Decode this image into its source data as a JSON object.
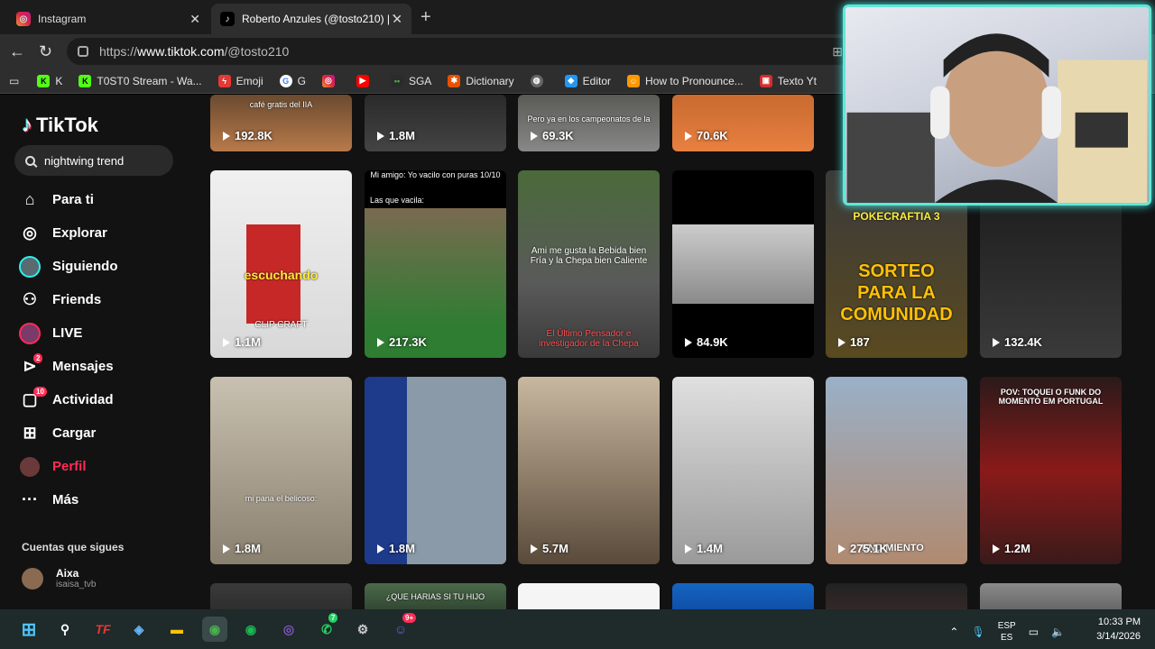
{
  "browser": {
    "tabs": [
      {
        "title": "Instagram",
        "active": false
      },
      {
        "title": "Roberto Anzules (@tosto210) | Tik",
        "active": true
      }
    ],
    "url_prefix": "https://",
    "url_domain": "www.tiktok.com",
    "url_path": "/@tosto210",
    "bookmarks": [
      "K",
      "T0ST0 Stream - Wa...",
      "Emoji",
      "G",
      "",
      "",
      "SGA",
      "Dictionary",
      "",
      "Editor",
      "How to Pronounce...",
      "Texto Yt"
    ]
  },
  "sidebar": {
    "logo": "TikTok",
    "search_value": "nightwing trend",
    "nav": [
      {
        "label": "Para ti",
        "icon": "home-icon"
      },
      {
        "label": "Explorar",
        "icon": "compass-icon"
      },
      {
        "label": "Siguiendo",
        "icon": "following-avatar-icon"
      },
      {
        "label": "Friends",
        "icon": "friends-icon"
      },
      {
        "label": "LIVE",
        "icon": "live-icon"
      },
      {
        "label": "Mensajes",
        "icon": "messages-icon",
        "badge": "2"
      },
      {
        "label": "Actividad",
        "icon": "activity-icon",
        "badge": "10"
      },
      {
        "label": "Cargar",
        "icon": "upload-icon"
      },
      {
        "label": "Perfil",
        "icon": "profile-avatar-icon",
        "active": true
      },
      {
        "label": "Más",
        "icon": "more-icon"
      }
    ],
    "following_title": "Cuentas que sigues",
    "following": [
      {
        "name": "Aixa",
        "handle": "isaisa_tvb"
      }
    ]
  },
  "videos": {
    "row1": [
      {
        "views": "192.8K",
        "caption": "café gratis del IIA"
      },
      {
        "views": "1.8M",
        "caption": ""
      },
      {
        "views": "69.3K",
        "caption": "Pero ya en los campeonatos de la"
      },
      {
        "views": "70.6K",
        "caption": ""
      }
    ],
    "row2": [
      {
        "views": "1.1M",
        "caption": "escuchando",
        "caption2": "CLIP CRAFT"
      },
      {
        "views": "217.3K",
        "caption": "Mi amigo: Yo vacilo con puras 10/10",
        "caption2": "Las que vacila:"
      },
      {
        "views": "",
        "caption": "Ami me gusta la Bebida bien Fría y la Chepa bien Caliente",
        "caption2": "El Último Pensador e investigador de la Chepa"
      },
      {
        "views": "84.9K",
        "caption": ""
      },
      {
        "views": "187",
        "caption": "POKECRAFTIA 3",
        "caption2": "SORTEO PARA LA COMUNIDAD"
      },
      {
        "views": "132.4K",
        "caption": ""
      }
    ],
    "row3": [
      {
        "views": "1.8M",
        "caption": "mi pana el belicoso:"
      },
      {
        "views": "1.8M",
        "caption": ""
      },
      {
        "views": "5.7M",
        "caption": ""
      },
      {
        "views": "1.4M",
        "caption": ""
      },
      {
        "views": "275.1K",
        "caption": "ENDIMIENTO"
      },
      {
        "views": "1.2M",
        "caption": "POV: TOQUEI O FUNK DO MOMENTO EM PORTUGAL"
      }
    ],
    "row4": [
      {
        "caption": ""
      },
      {
        "caption": "¿QUE HARIAS SI TU HIJO"
      },
      {
        "caption": ""
      },
      {
        "caption": ""
      },
      {
        "caption": ""
      },
      {
        "caption": ""
      }
    ]
  },
  "taskbar": {
    "lang1": "ESP",
    "lang2": "ES",
    "time": "10:33 PM",
    "date": "3/14/2026",
    "whatsapp_badge": "7",
    "discord_badge": "9+"
  },
  "colors": {
    "tiktok_red": "#fe2c55",
    "tiktok_cyan": "#25f4ee",
    "cam_border": "#5ee8d6"
  }
}
